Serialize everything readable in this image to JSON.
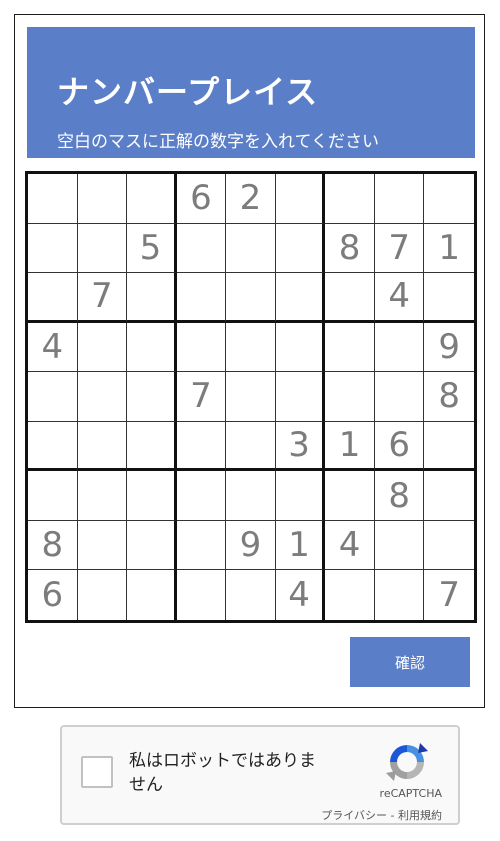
{
  "header": {
    "title": "ナンバープレイス",
    "subtitle": "空白のマスに正解の数字を入れてください"
  },
  "puzzle": {
    "rows": [
      [
        "",
        "",
        "",
        "6",
        "2",
        "",
        "",
        "",
        ""
      ],
      [
        "",
        "",
        "5",
        "",
        "",
        "",
        "8",
        "7",
        "1"
      ],
      [
        "",
        "7",
        "",
        "",
        "",
        "",
        "",
        "4",
        ""
      ],
      [
        "4",
        "",
        "",
        "",
        "",
        "",
        "",
        "",
        "9"
      ],
      [
        "",
        "",
        "",
        "7",
        "",
        "",
        "",
        "",
        "8"
      ],
      [
        "",
        "",
        "",
        "",
        "",
        "3",
        "1",
        "6",
        ""
      ],
      [
        "",
        "",
        "",
        "",
        "",
        "",
        "",
        "8",
        ""
      ],
      [
        "8",
        "",
        "",
        "",
        "9",
        "1",
        "4",
        "",
        ""
      ],
      [
        "6",
        "",
        "",
        "",
        "",
        "4",
        "",
        "",
        "7"
      ]
    ]
  },
  "confirm_label": "確認",
  "captcha": {
    "label": "私はロボットではありません",
    "brand": "reCAPTCHA",
    "privacy": "プライバシー",
    "separator": " - ",
    "terms": "利用規約"
  },
  "colors": {
    "accent": "#5b7ec8",
    "given_digit": "#7c7c7c",
    "grid_line": "#111111"
  }
}
